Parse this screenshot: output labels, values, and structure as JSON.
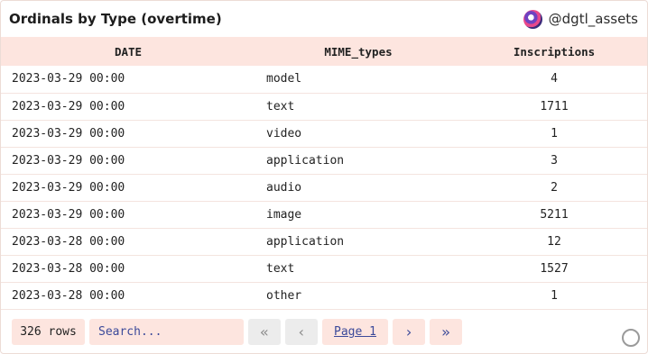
{
  "header": {
    "title": "Ordinals by Type (overtime)",
    "handle": "@dgtl_assets"
  },
  "table": {
    "columns": [
      "DATE",
      "MIME_types",
      "Inscriptions"
    ],
    "rows": [
      [
        "2023-03-29 00:00",
        "model",
        "4"
      ],
      [
        "2023-03-29 00:00",
        "text",
        "1711"
      ],
      [
        "2023-03-29 00:00",
        "video",
        "1"
      ],
      [
        "2023-03-29 00:00",
        "application",
        "3"
      ],
      [
        "2023-03-29 00:00",
        "audio",
        "2"
      ],
      [
        "2023-03-29 00:00",
        "image",
        "5211"
      ],
      [
        "2023-03-28 00:00",
        "application",
        "12"
      ],
      [
        "2023-03-28 00:00",
        "text",
        "1527"
      ],
      [
        "2023-03-28 00:00",
        "other",
        "1"
      ]
    ]
  },
  "footer": {
    "row_count": "326 rows",
    "search_placeholder": "Search...",
    "first_icon": "«",
    "prev_icon": "‹",
    "page_label": "Page 1",
    "next_icon": "›",
    "last_icon": "»"
  },
  "colors": {
    "header_bg": "#fde5df",
    "accent_text": "#3c4a9a"
  }
}
